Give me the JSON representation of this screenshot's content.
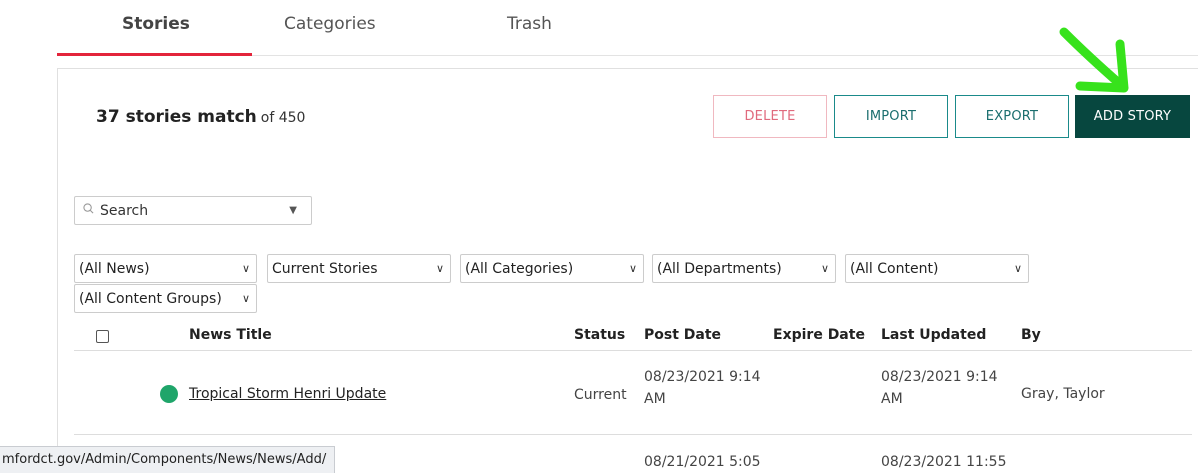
{
  "tabs": [
    {
      "label": "Stories",
      "active": true
    },
    {
      "label": "Categories",
      "active": false
    },
    {
      "label": "Trash",
      "active": false
    }
  ],
  "summary": {
    "count_text": "37 stories match",
    "of_text": "of 450"
  },
  "toolbar": {
    "delete_label": "DELETE",
    "import_label": "IMPORT",
    "export_label": "EXPORT",
    "add_label": "ADD STORY"
  },
  "search": {
    "value": "Search",
    "icon": "search-icon"
  },
  "filters": [
    "(All News)",
    "Current Stories",
    "(All Categories)",
    "(All Departments)",
    "(All Content)",
    "(All Content Groups)"
  ],
  "table": {
    "headers": [
      "News Title",
      "Status",
      "Post Date",
      "Expire Date",
      "Last Updated",
      "By"
    ],
    "rows": [
      {
        "title": "Tropical Storm Henri Update",
        "status": "Current",
        "post_date_1": "08/23/2021 9:14",
        "post_date_2": "AM",
        "expire_date": "",
        "updated_1": "08/23/2021 9:14",
        "updated_2": "AM",
        "by": "Gray, Taylor"
      },
      {
        "title": "",
        "status": "",
        "post_date_1": "08/21/2021 5:05",
        "post_date_2": "",
        "expire_date": "",
        "updated_1": "08/23/2021 11:55",
        "updated_2": "",
        "by": ""
      }
    ]
  },
  "status_bar": {
    "url": "mfordct.gov/Admin/Components/News/News/Add/"
  },
  "colors": {
    "accent_red": "#e3243b",
    "primary_dark": "#07473f",
    "teal": "#1a6e6e",
    "status_green": "#1fa56a",
    "annotation_green": "#37e21c"
  }
}
